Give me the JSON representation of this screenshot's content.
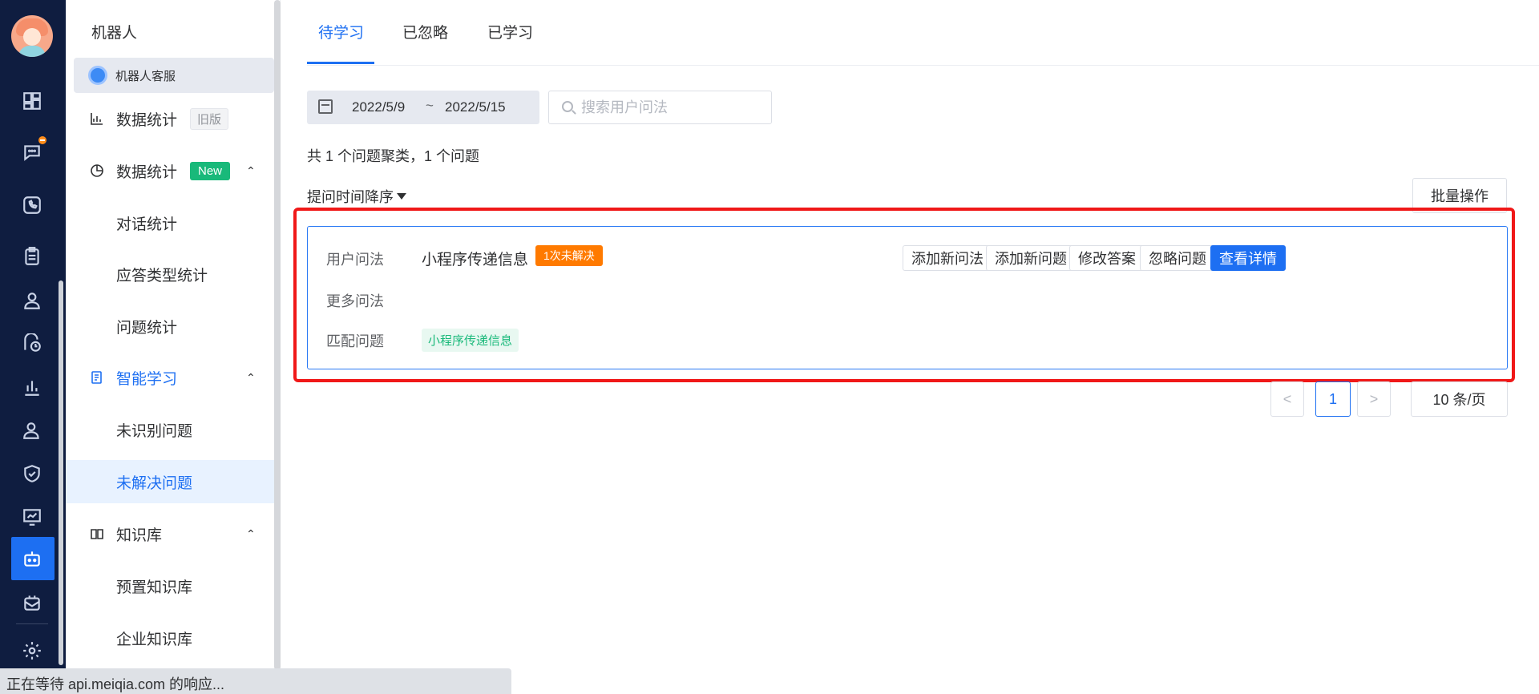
{
  "menu": {
    "title": "机器人",
    "robot_tab": "机器人客服",
    "items": [
      {
        "label": "数据统计",
        "tag": "旧版"
      },
      {
        "label": "数据统计",
        "tag": "New"
      },
      {
        "label": "对话统计"
      },
      {
        "label": "应答类型统计"
      },
      {
        "label": "问题统计"
      },
      {
        "label": "智能学习"
      },
      {
        "label": "未识别问题"
      },
      {
        "label": "未解决问题"
      },
      {
        "label": "知识库"
      },
      {
        "label": "预置知识库"
      },
      {
        "label": "企业知识库"
      }
    ]
  },
  "tabs": [
    "待学习",
    "已忽略",
    "已学习"
  ],
  "filter": {
    "date_start": "2022/5/9",
    "date_sep": "~",
    "date_end": "2022/5/15",
    "search_placeholder": "搜索用户问法"
  },
  "summary": "共 1 个问题聚类，1 个问题",
  "sort_label": "提问时间降序",
  "batch_label": "批量操作",
  "card": {
    "label_user_question": "用户问法",
    "label_more": "更多问法",
    "label_match": "匹配问题",
    "question": "小程序传递信息",
    "unresolved_badge": "1次未解决",
    "match_tag": "小程序传递信息",
    "actions": [
      "添加新问法",
      "添加新问题",
      "修改答案",
      "忽略问题",
      "查看详情"
    ]
  },
  "pagination": {
    "prev": "<",
    "page": "1",
    "next": ">",
    "page_size": "10 条/页"
  },
  "status_bar": "正在等待 api.meiqia.com 的响应...",
  "colors": {
    "rail_bg": "#0f1d40",
    "accent": "#1d6ff2",
    "new_tag": "#19b97a",
    "unresolved": "#ff7a00",
    "highlight": "#f01818"
  }
}
